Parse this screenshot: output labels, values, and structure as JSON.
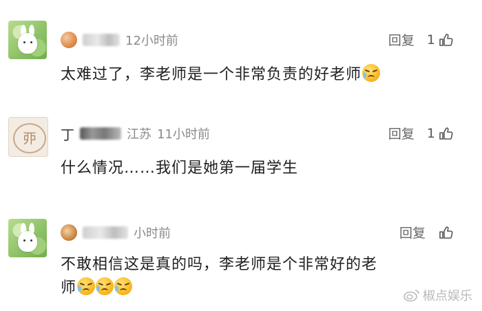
{
  "comments": [
    {
      "name_visible": "",
      "time": "12小时前",
      "text": "太难过了，李老师是一个非常负责的好老师",
      "emojis": 1,
      "reply_label": "回复",
      "likes": "1"
    },
    {
      "name_visible": "丁",
      "location": "江苏",
      "time": "11小时前",
      "text": "什么情况……我们是她第一届学生",
      "reply_label": "回复",
      "likes": "1",
      "avatar_glyph": "丣"
    },
    {
      "time": "小时前",
      "text_line1": "不敢相信这是真的吗，李老师是个非常好的老",
      "text_line2": "师",
      "emojis": 3,
      "reply_label": "回复"
    }
  ],
  "watermark": {
    "text": "椒点娱乐",
    "icon": "weibo-icon"
  },
  "icons": {
    "like": "thumbs-up-icon"
  },
  "colors": {
    "meta": "#8a8a8a",
    "text": "#1f1f1f",
    "watermark": "#b9b9b9"
  }
}
